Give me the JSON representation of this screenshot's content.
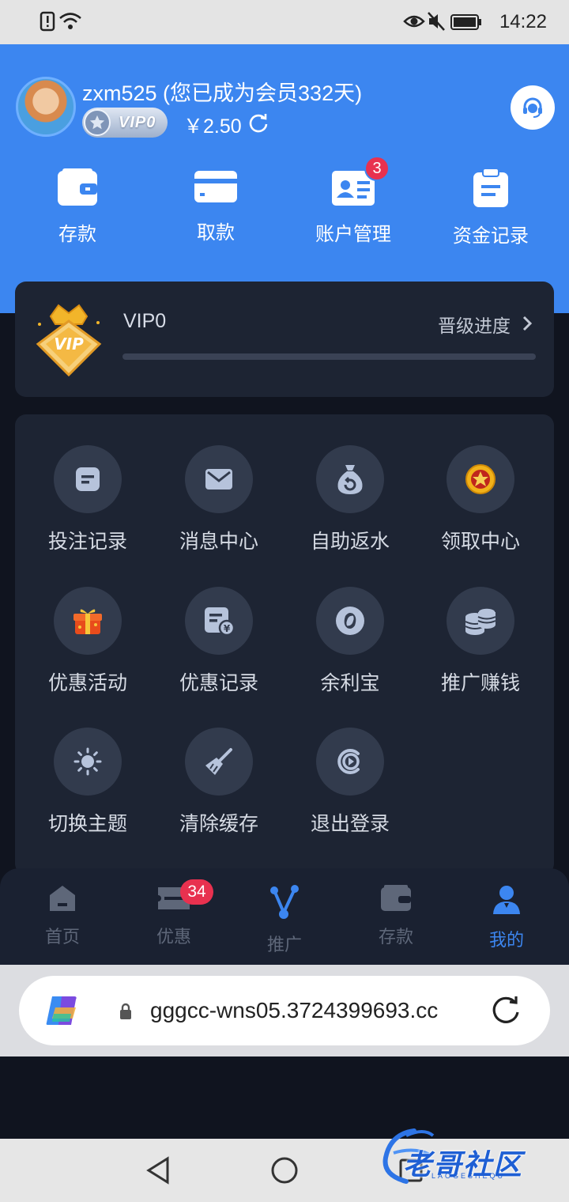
{
  "status_bar": {
    "time": "14:22"
  },
  "header": {
    "username": "zxm525 (您已成为会员332天)",
    "vip_badge": "VIP0",
    "balance": "￥2.50",
    "quick_actions": [
      {
        "label": "存款",
        "icon": "wallet-icon"
      },
      {
        "label": "取款",
        "icon": "card-icon"
      },
      {
        "label": "账户管理",
        "icon": "id-card-icon",
        "badge": "3"
      },
      {
        "label": "资金记录",
        "icon": "clipboard-icon"
      }
    ]
  },
  "vip_card": {
    "level": "VIP0",
    "progress_label": "晋级进度",
    "progress": 0.0
  },
  "menu_grid": [
    {
      "label": "投注记录",
      "icon": "note-icon"
    },
    {
      "label": "消息中心",
      "icon": "mail-icon"
    },
    {
      "label": "自助返水",
      "icon": "money-bag-icon"
    },
    {
      "label": "领取中心",
      "icon": "gold-coin-icon"
    },
    {
      "label": "优惠活动",
      "icon": "gift-icon"
    },
    {
      "label": "优惠记录",
      "icon": "receipt-yen-icon"
    },
    {
      "label": "余利宝",
      "icon": "yulibao-icon"
    },
    {
      "label": "推广赚钱",
      "icon": "coin-stack-icon"
    },
    {
      "label": "切换主题",
      "icon": "sun-icon"
    },
    {
      "label": "清除缓存",
      "icon": "broom-icon"
    },
    {
      "label": "退出登录",
      "icon": "logout-icon"
    }
  ],
  "bottom_nav": [
    {
      "label": "首页",
      "icon": "home-icon"
    },
    {
      "label": "优惠",
      "icon": "ticket-icon",
      "badge": "34"
    },
    {
      "label": "推广",
      "icon": "share-icon"
    },
    {
      "label": "存款",
      "icon": "wallet-icon"
    },
    {
      "label": "我的",
      "icon": "user-icon",
      "active": true
    }
  ],
  "browser": {
    "url": "gggcc-wns05.3724399693.cc"
  },
  "watermark": {
    "text": "老哥社区",
    "sub": "LAOGESHEQU"
  },
  "colors": {
    "primary": "#3c86f0",
    "card": "#1d2433",
    "background": "#10141f",
    "badge": "#e8314f"
  }
}
